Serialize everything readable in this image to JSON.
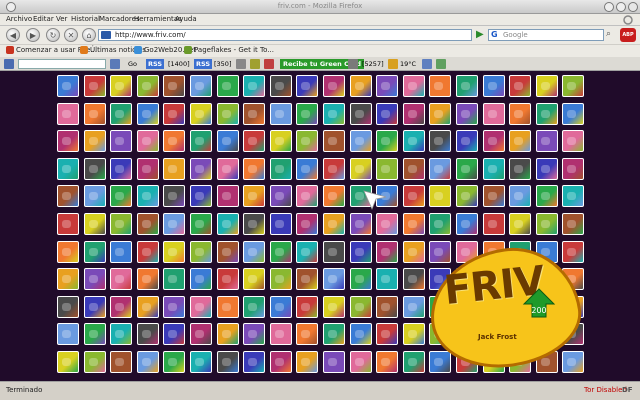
{
  "window": {
    "title": "friv.com - Mozilla Firefox"
  },
  "menu": [
    "Archivo",
    "Editar",
    "Ver",
    "Historial",
    "Marcadores",
    "Herramientas",
    "Ayuda"
  ],
  "nav": {
    "url": "http://www.friv.com/",
    "search_placeholder": "Google",
    "adblock_label": "ABP"
  },
  "bookmarks": [
    {
      "label": "Comenzar a usar Fire...",
      "color": "#c8331f"
    },
    {
      "label": "Últimas noticias",
      "color": "#e07a1a"
    },
    {
      "label": "Go2Web20.net",
      "color": "#3a8fd8"
    },
    {
      "label": "Pageflakes - Get it To...",
      "color": "#6a9a2a"
    }
  ],
  "toolbar": {
    "go_label": "Go",
    "rss_label": "RSS",
    "count_1400": "[1400]",
    "count_350": "[350]",
    "green_card": "Recibe tu Green Card",
    "count_5257": "[5257]",
    "weather": "19°C"
  },
  "logo": {
    "text": "FRIV",
    "sub": "Jack Frost",
    "badge_number": "200",
    "brand_color": "#f7c41a"
  },
  "status": {
    "text": "Terminado",
    "tor": "Tor Disabled",
    "df": "DF"
  },
  "grid": {
    "cols": 20,
    "rows": 11
  }
}
